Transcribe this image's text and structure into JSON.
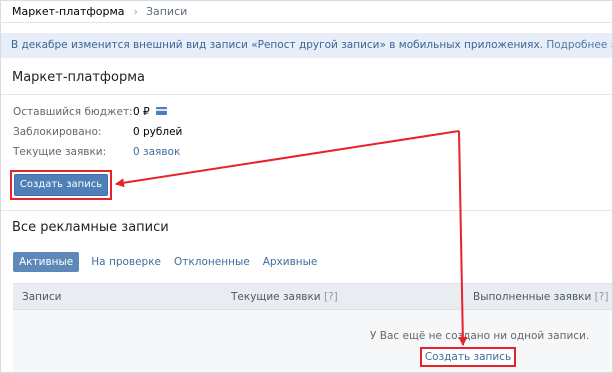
{
  "breadcrumb": {
    "root": "Маркет-платформа",
    "separator": "›",
    "current": "Записи"
  },
  "banner": {
    "text": "В декабре изменится внешний вид записи «Репост другой записи» в мобильных приложениях.",
    "link": "Подробнее",
    "chevron": "›"
  },
  "market": {
    "title": "Маркет-платформа",
    "stats": [
      {
        "label": "Оставшийся бюджет:",
        "value": "0 ₽",
        "icon": "card-icon"
      },
      {
        "label": "Заблокировано:",
        "value": "0 рублей"
      },
      {
        "label": "Текущие заявки:",
        "value": "0 заявок"
      }
    ],
    "create_button": "Создать запись"
  },
  "ads": {
    "title": "Все рекламные записи",
    "tabs": [
      "Активные",
      "На проверке",
      "Отклоненные",
      "Архивные"
    ],
    "active_tab": "Активные",
    "columns": [
      {
        "label": "Записи"
      },
      {
        "label": "Текущие заявки",
        "hint": "[?]"
      },
      {
        "label": "Выполненные заявки",
        "hint": "[?]"
      }
    ],
    "empty_text": "У Вас ещё не создано ни одной записи.",
    "create_link": "Создать запись"
  },
  "colors": {
    "accent": "#4e7fb7",
    "highlight": "#e8222a",
    "banner_bg": "#e7eef7"
  }
}
